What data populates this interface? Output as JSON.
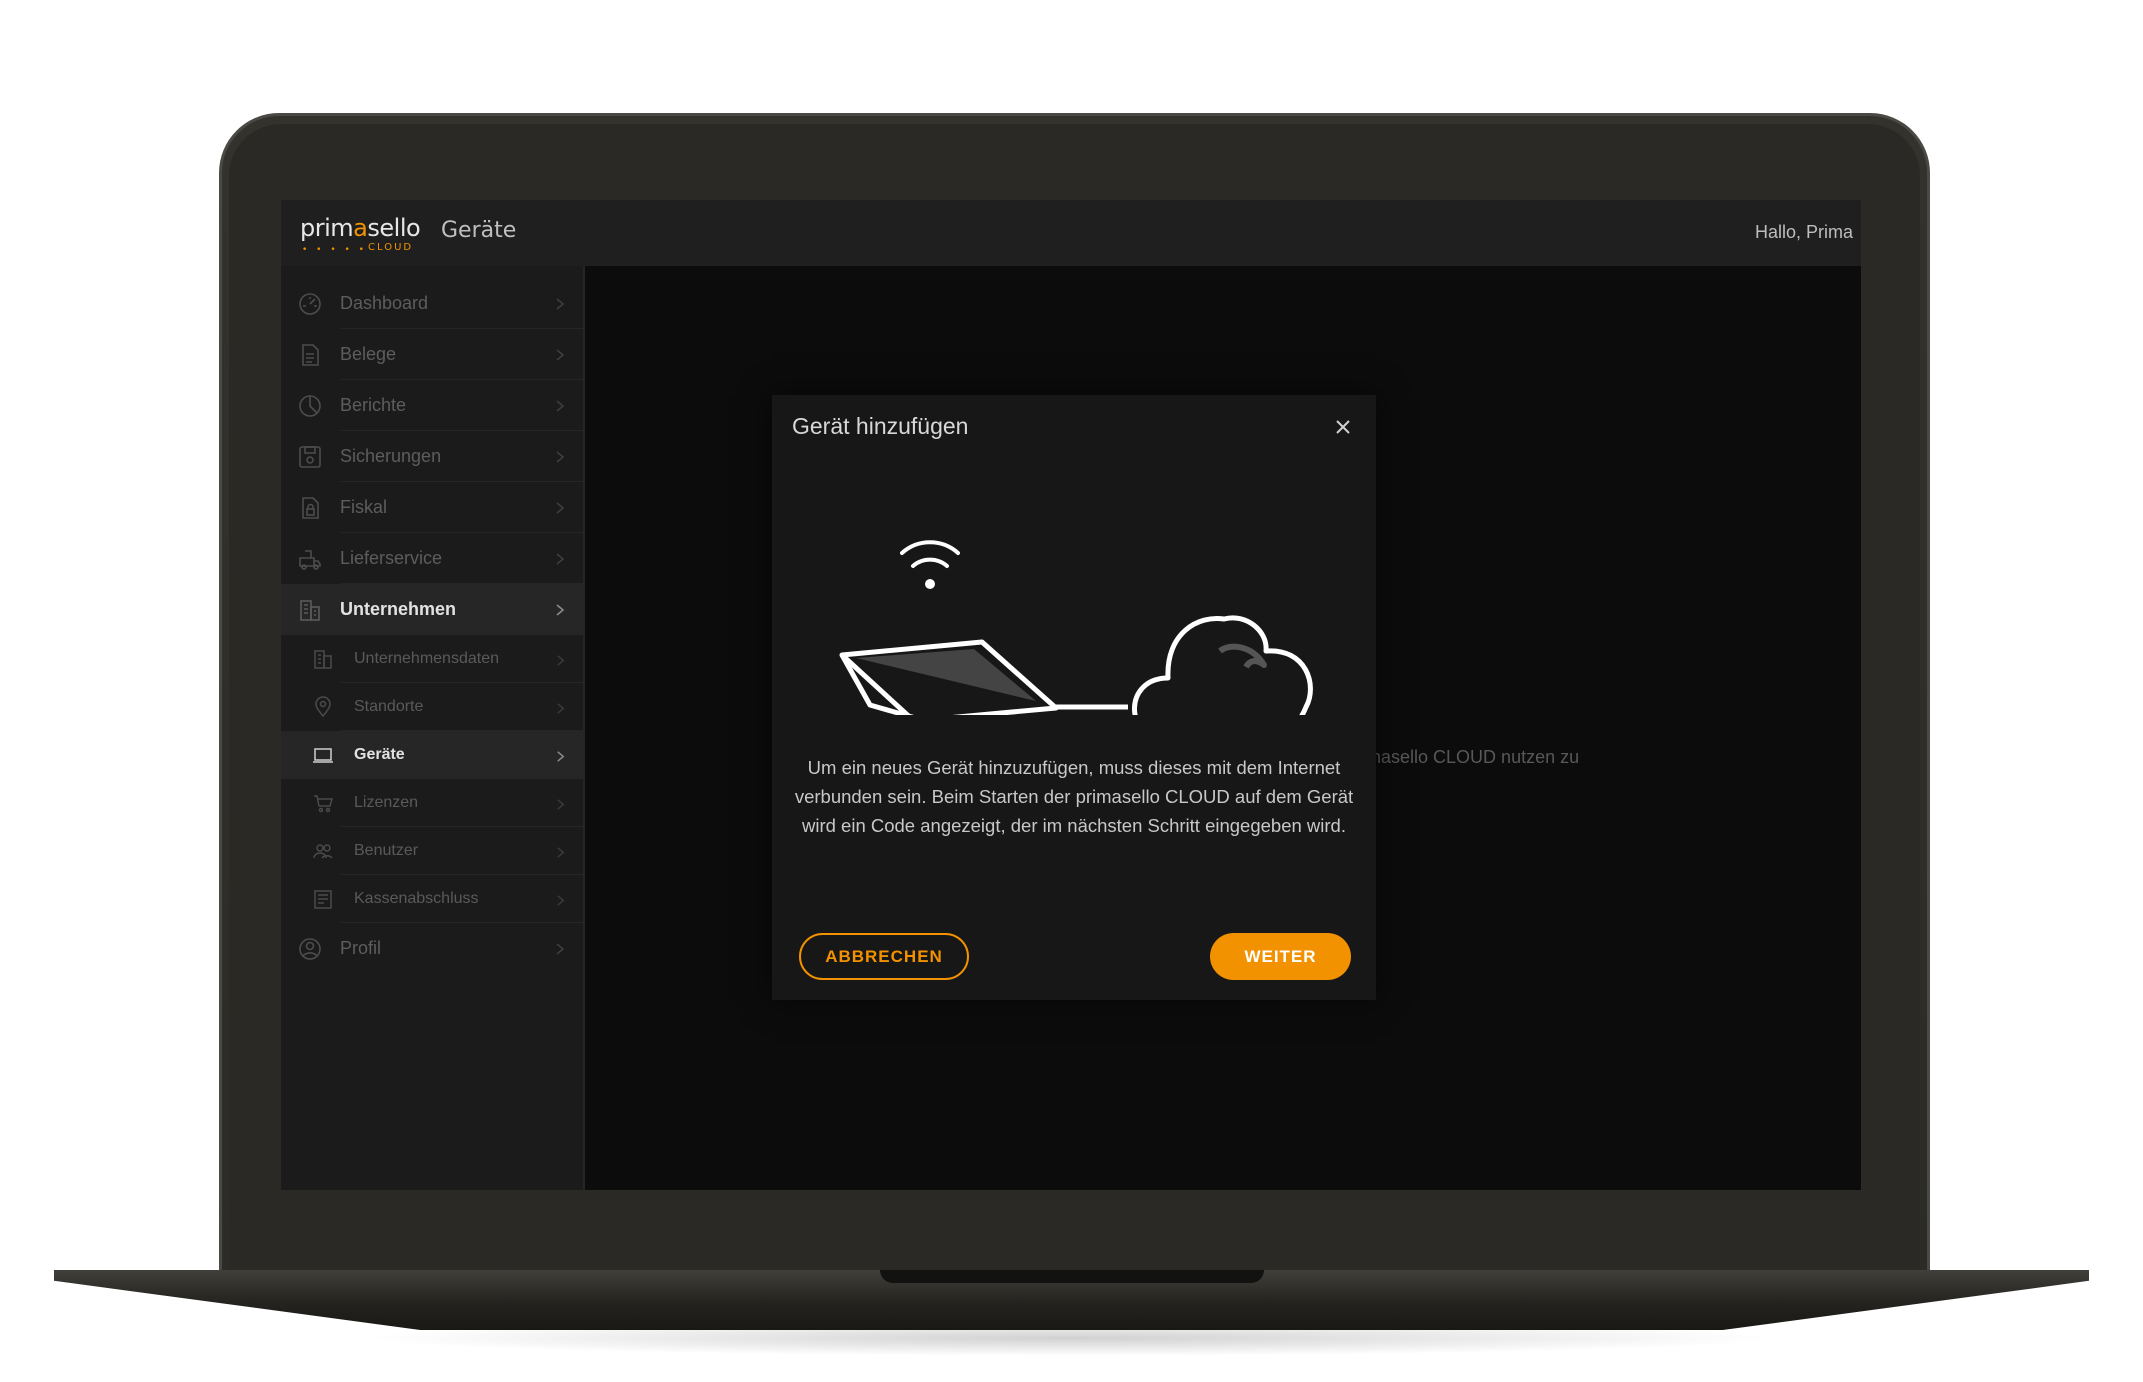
{
  "app": {
    "logo_prefix": "prim",
    "logo_accent": "a",
    "logo_suffix": "sello",
    "logo_dots": "• • • • •",
    "logo_sub": "CLOUD",
    "page_title": "Geräte",
    "greeting": "Hallo, Prima"
  },
  "sidebar": {
    "items": [
      {
        "label": "Dashboard",
        "icon": "dashboard-icon"
      },
      {
        "label": "Belege",
        "icon": "document-icon"
      },
      {
        "label": "Berichte",
        "icon": "pie-chart-icon"
      },
      {
        "label": "Sicherungen",
        "icon": "save-icon"
      },
      {
        "label": "Fiskal",
        "icon": "fiscal-lock-icon"
      },
      {
        "label": "Lieferservice",
        "icon": "delivery-icon"
      },
      {
        "label": "Unternehmen",
        "icon": "building-icon",
        "active": true
      },
      {
        "label": "Profil",
        "icon": "user-circle-icon"
      }
    ],
    "sub_items": [
      {
        "label": "Unternehmensdaten",
        "icon": "building-small-icon"
      },
      {
        "label": "Standorte",
        "icon": "location-pin-icon"
      },
      {
        "label": "Geräte",
        "icon": "laptop-icon",
        "active": true
      },
      {
        "label": "Lizenzen",
        "icon": "cart-icon"
      },
      {
        "label": "Benutzer",
        "icon": "users-icon"
      },
      {
        "label": "Kassenabschluss",
        "icon": "register-report-icon"
      }
    ]
  },
  "content": {
    "background_text": "nasello CLOUD nutzen zu"
  },
  "modal": {
    "title": "Gerät hinzufügen",
    "close_icon": "close-icon",
    "body": "Um ein neues Gerät hinzuzufügen, muss dieses mit dem Internet verbunden sein. Beim Starten der primasello CLOUD auf dem Gerät wird ein Code angezeigt, der im nächsten Schritt eingegeben wird.",
    "cancel_label": "ABBRECHEN",
    "next_label": "WEITER"
  },
  "colors": {
    "accent": "#f39200",
    "screen_bg": "#0c0c0c",
    "sidebar_bg": "#1b1b1b",
    "modal_bg": "#171717"
  }
}
